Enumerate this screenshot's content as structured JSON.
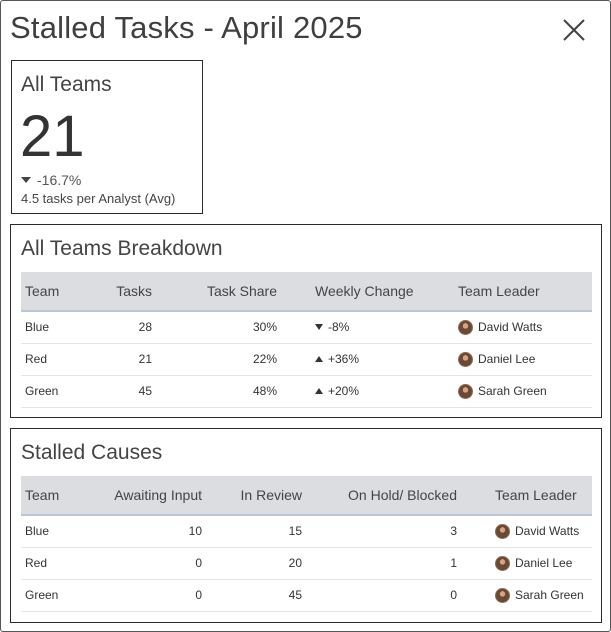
{
  "header": {
    "title": "Stalled Tasks - April 2025",
    "close_icon": "close-icon"
  },
  "kpi": {
    "title": "All Teams",
    "value": "21",
    "change": "-16.7%",
    "change_direction": "down",
    "subtitle": "4.5 tasks per Analyst (Avg)"
  },
  "breakdown": {
    "title": "All Teams Breakdown",
    "columns": [
      "Team",
      "Tasks",
      "Task Share",
      "Weekly Change",
      "Team Leader"
    ],
    "rows": [
      {
        "team": "Blue",
        "tasks": "28",
        "share": "30%",
        "change": "-8%",
        "direction": "down",
        "leader": "David Watts"
      },
      {
        "team": "Red",
        "tasks": "21",
        "share": "22%",
        "change": "+36%",
        "direction": "up",
        "leader": "Daniel Lee"
      },
      {
        "team": "Green",
        "tasks": "45",
        "share": "48%",
        "change": "+20%",
        "direction": "up",
        "leader": "Sarah Green"
      }
    ]
  },
  "causes": {
    "title": "Stalled Causes",
    "columns": [
      "Team",
      "Awaiting Input",
      "In Review",
      "On Hold/ Blocked",
      "Team Leader"
    ],
    "rows": [
      {
        "team": "Blue",
        "awaiting": "10",
        "review": "15",
        "hold": "3",
        "leader": "David Watts"
      },
      {
        "team": "Red",
        "awaiting": "0",
        "review": "20",
        "hold": "1",
        "leader": "Daniel Lee"
      },
      {
        "team": "Green",
        "awaiting": "0",
        "review": "45",
        "hold": "0",
        "leader": "Sarah Green"
      }
    ]
  }
}
